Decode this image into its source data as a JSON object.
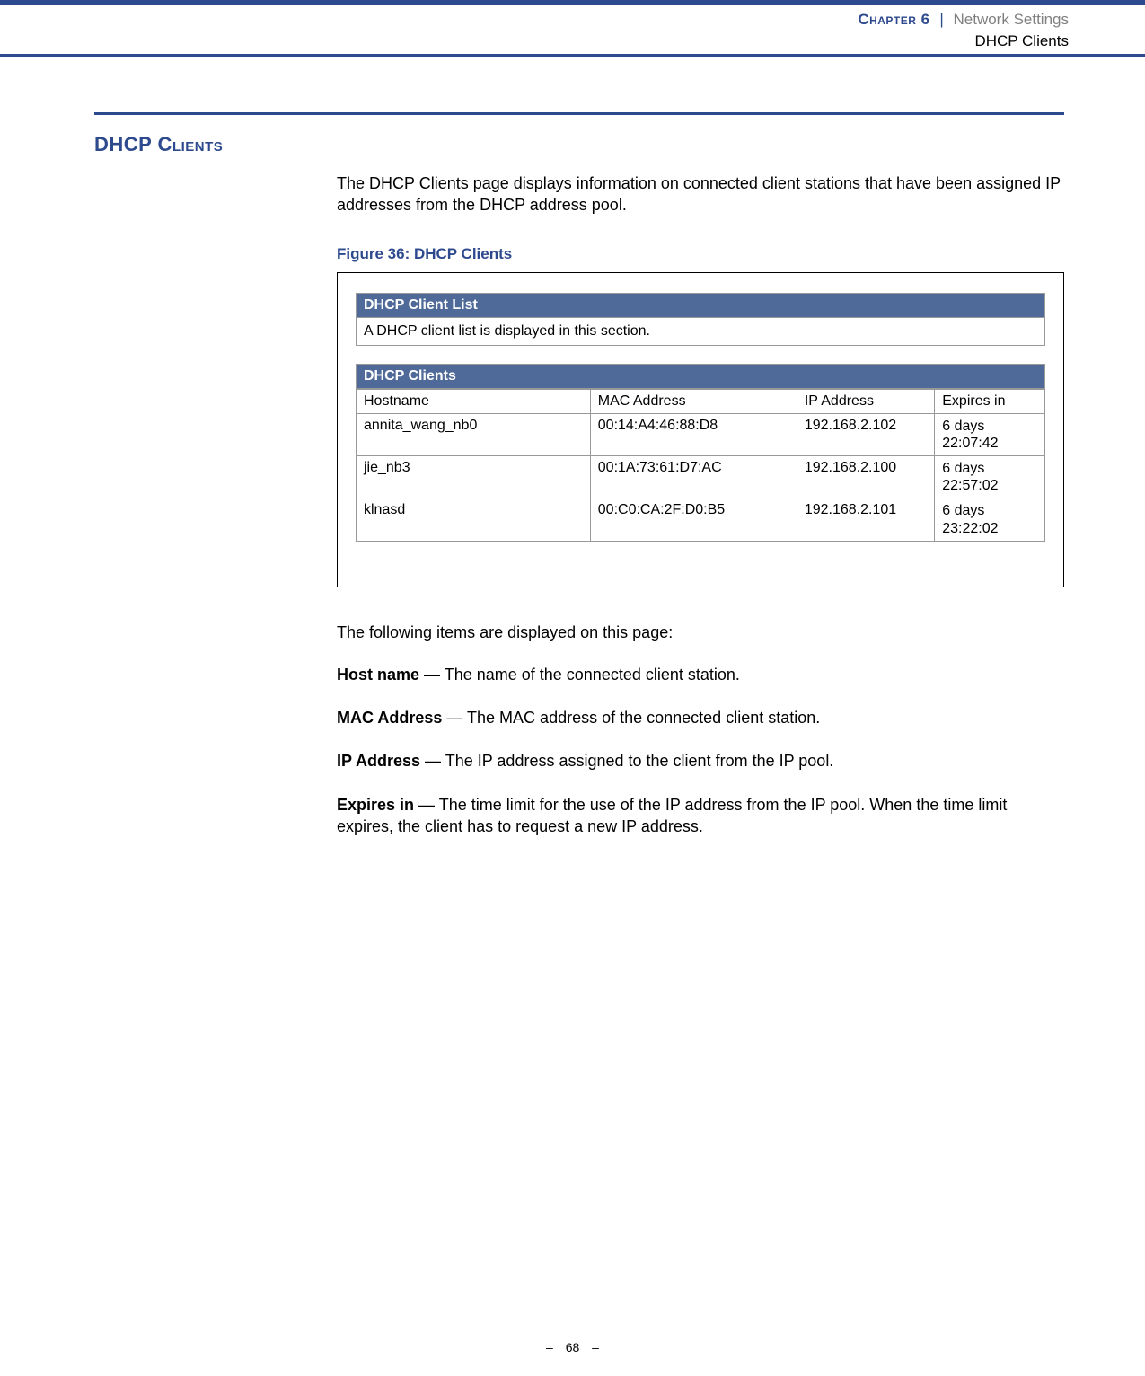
{
  "header": {
    "chapter": "Chapter 6",
    "separator": "|",
    "title": "Network Settings",
    "subtitle": "DHCP Clients"
  },
  "section_heading": "DHCP Clients",
  "intro_text": "The DHCP Clients page displays information on connected client stations that have been assigned IP addresses from the DHCP address pool.",
  "figure_caption": "Figure 36:  DHCP Clients",
  "figure": {
    "panel1_title": "DHCP Client List",
    "panel1_desc": "A DHCP client list is displayed in this section.",
    "panel2_title": "DHCP Clients",
    "columns": {
      "hostname": "Hostname",
      "mac": "MAC Address",
      "ip": "IP Address",
      "expires": "Expires in"
    },
    "rows": [
      {
        "hostname": "annita_wang_nb0",
        "mac": "00:14:A4:46:88:D8",
        "ip": "192.168.2.102",
        "expires": "6 days\n22:07:42"
      },
      {
        "hostname": "jie_nb3",
        "mac": "00:1A:73:61:D7:AC",
        "ip": "192.168.2.100",
        "expires": "6 days\n22:57:02"
      },
      {
        "hostname": "klnasd",
        "mac": "00:C0:CA:2F:D0:B5",
        "ip": "192.168.2.101",
        "expires": "6 days\n23:22:02"
      }
    ]
  },
  "followup_text": "The following items are displayed on this page:",
  "definitions": [
    {
      "term": "Host name",
      "desc": " — The name of the connected client station."
    },
    {
      "term": "MAC Address",
      "desc": " — The MAC address of the connected client station."
    },
    {
      "term": "IP Address",
      "desc": " — The IP address assigned to the client from the IP pool."
    },
    {
      "term": "Expires in",
      "desc": " — The time limit for the use of the IP address from the IP pool. When the time limit expires, the client has to request a new IP address."
    }
  ],
  "footer": {
    "dash": "–",
    "page_number": "68"
  }
}
